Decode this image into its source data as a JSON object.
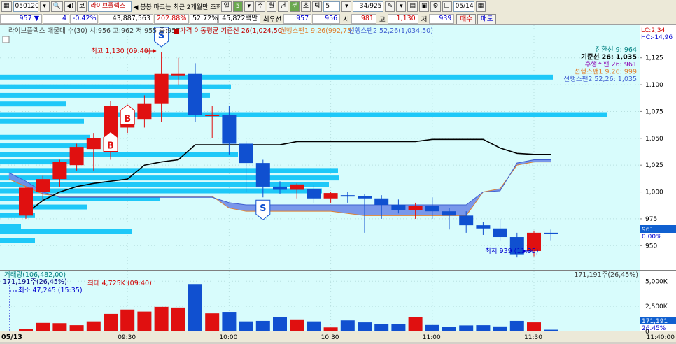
{
  "toolbar": {
    "code": "050120",
    "name": "라이브플렉스",
    "ticker_prefix": "코",
    "notice": "◀ 봉봉 마크는 최근 2개월만 조회",
    "periods": [
      "일",
      "5",
      "주",
      "월",
      "년",
      "분",
      "초",
      "틱"
    ],
    "interval": "5",
    "page": "34/925",
    "date": "05/14"
  },
  "quote": {
    "price": "957",
    "change": "4",
    "change_pct": "-0.42%",
    "volume": "43,887,563",
    "vol_ratio": "202.88%",
    "strength": "52.72%",
    "amount": "45,822백만",
    "best_label": "최우선",
    "ask": "957",
    "bid": "956",
    "open_label": "시",
    "open": "981",
    "high_label": "고",
    "high": "1,130",
    "low_label": "저",
    "low": "939",
    "buy_label": "매수",
    "sell_label": "매도"
  },
  "chart": {
    "header": "라이브플렉스 매물대 수(30) 시:956 고:962 저:955 종:957",
    "ma_label": "■가격 이동평균 기준선 26(1,024,50)",
    "span1_label": "선행스팬1 9,26(992,75)",
    "span2_label": "선행스팬2 52,26(1,034,50)",
    "lc_label": "LC:2,34",
    "hc_label": "HC:-14,96",
    "legend": [
      {
        "text": "전환선 9: 964",
        "color": "#008080"
      },
      {
        "text": "기준선 26: 1,035",
        "color": "#000000"
      },
      {
        "text": "후행스팬 26: 961",
        "color": "#8b00b0"
      },
      {
        "text": "선행스팬1 9,26: 999",
        "color": "#e08030"
      },
      {
        "text": "선행스팬2 52,26: 1,035",
        "color": "#4060d0"
      }
    ],
    "high_annot": "최고 1,130 (09:40)",
    "low_annot": "최저 939 (11:35)",
    "price_tag": "961",
    "pct_tag": "0.00%",
    "volume_header": "거래량(106,482,00)",
    "volume_right": "171,191주(26,45%)",
    "volume_current": "171,191주(26,45%)",
    "volume_min": "최소 47,245 (15:35)",
    "volume_max": "최대 4,725K (09:40)",
    "volume_tag": "171,191",
    "volume_pct_tag": "26.45%",
    "date_label": "05/13",
    "end_time": "11:40:00"
  },
  "chart_data": {
    "type": "candlestick",
    "interval_minutes": 5,
    "price_axis": {
      "min": 930,
      "max": 1145,
      "ticks": [
        950,
        975,
        1000,
        1025,
        1050,
        1075,
        1100,
        1125
      ]
    },
    "price_tick_labels": [
      "950",
      "975",
      "1,000",
      "1,025",
      "1,050",
      "1,075",
      "1,100",
      "1,125"
    ],
    "volume_axis": {
      "max": 5300,
      "ticks": [
        0,
        2500,
        5000
      ],
      "tick_labels": [
        "0",
        "2,500K",
        "5,000K"
      ]
    },
    "time_labels": [
      "09:30",
      "10:00",
      "10:30",
      "11:00",
      "11:30"
    ],
    "candles": [
      {
        "o": 978,
        "h": 1005,
        "l": 975,
        "c": 1004
      },
      {
        "o": 1000,
        "h": 1015,
        "l": 992,
        "c": 1012
      },
      {
        "o": 1012,
        "h": 1030,
        "l": 1005,
        "c": 1028
      },
      {
        "o": 1025,
        "h": 1045,
        "l": 1020,
        "c": 1042
      },
      {
        "o": 1040,
        "h": 1055,
        "l": 1020,
        "c": 1050
      },
      {
        "o": 1050,
        "h": 1085,
        "l": 1030,
        "c": 1080
      },
      {
        "o": 1060,
        "h": 1075,
        "l": 1055,
        "c": 1068
      },
      {
        "o": 1068,
        "h": 1090,
        "l": 1060,
        "c": 1082
      },
      {
        "o": 1082,
        "h": 1130,
        "l": 1065,
        "c": 1110
      },
      {
        "o": 1110,
        "h": 1125,
        "l": 1100,
        "c": 1110
      },
      {
        "o": 1110,
        "h": 1120,
        "l": 1065,
        "c": 1072
      },
      {
        "o": 1072,
        "h": 1080,
        "l": 1050,
        "c": 1072
      },
      {
        "o": 1072,
        "h": 1080,
        "l": 1035,
        "c": 1045
      },
      {
        "o": 1045,
        "h": 1048,
        "l": 1000,
        "c": 1027
      },
      {
        "o": 1027,
        "h": 1030,
        "l": 995,
        "c": 1005
      },
      {
        "o": 1005,
        "h": 1010,
        "l": 998,
        "c": 1002
      },
      {
        "o": 1002,
        "h": 1008,
        "l": 994,
        "c": 1007
      },
      {
        "o": 1003,
        "h": 1006,
        "l": 990,
        "c": 994
      },
      {
        "o": 994,
        "h": 1000,
        "l": 990,
        "c": 999
      },
      {
        "o": 997,
        "h": 1000,
        "l": 990,
        "c": 996
      },
      {
        "o": 996,
        "h": 998,
        "l": 962,
        "c": 994
      },
      {
        "o": 994,
        "h": 997,
        "l": 975,
        "c": 988
      },
      {
        "o": 988,
        "h": 993,
        "l": 980,
        "c": 983
      },
      {
        "o": 983,
        "h": 990,
        "l": 975,
        "c": 987
      },
      {
        "o": 987,
        "h": 995,
        "l": 975,
        "c": 982
      },
      {
        "o": 982,
        "h": 985,
        "l": 965,
        "c": 978
      },
      {
        "o": 978,
        "h": 982,
        "l": 962,
        "c": 969
      },
      {
        "o": 969,
        "h": 972,
        "l": 960,
        "c": 966
      },
      {
        "o": 966,
        "h": 975,
        "l": 955,
        "c": 958
      },
      {
        "o": 958,
        "h": 962,
        "l": 939,
        "c": 942
      },
      {
        "o": 945,
        "h": 964,
        "l": 940,
        "c": 962
      },
      {
        "o": 962,
        "h": 965,
        "l": 955,
        "c": 961
      }
    ],
    "volumes": [
      260,
      850,
      820,
      620,
      1000,
      1750,
      2180,
      1980,
      2450,
      2380,
      4725,
      1800,
      1950,
      1000,
      1050,
      1450,
      1200,
      1000,
      400,
      1100,
      900,
      760,
      740,
      1400,
      640,
      470,
      600,
      620,
      500,
      1050,
      900,
      171
    ],
    "kijun": [
      980,
      992,
      1000,
      1005,
      1008,
      1010,
      1012,
      1025,
      1028,
      1030,
      1044,
      1044,
      1044,
      1044,
      1044,
      1044,
      1047,
      1047,
      1047,
      1047,
      1047,
      1047,
      1047,
      1047,
      1049,
      1049,
      1049,
      1049,
      1041,
      1036,
      1035,
      1035
    ],
    "span1": [
      1012,
      1005,
      998,
      996,
      996,
      996,
      996,
      996,
      996,
      996,
      996,
      996,
      996,
      985,
      982,
      982,
      982,
      982,
      982,
      982,
      980,
      978,
      978,
      978,
      978,
      978,
      978,
      978,
      1000,
      1003,
      1025,
      1028,
      1028
    ],
    "span2": [
      1018,
      1010,
      1000,
      995,
      995,
      995,
      995,
      995,
      995,
      995,
      995,
      995,
      995,
      990,
      988,
      988,
      988,
      988,
      988,
      988,
      988,
      988,
      988,
      988,
      988,
      988,
      988,
      988,
      1000,
      1001,
      1027,
      1030,
      1030
    ],
    "signals": [
      {
        "type": "S",
        "candle": 8,
        "where": "above"
      },
      {
        "type": "B",
        "candle": 5,
        "where": "below"
      },
      {
        "type": "B",
        "candle": 6,
        "where": "below"
      },
      {
        "type": "S",
        "candle": 14,
        "where": "below"
      }
    ],
    "volume_profile_prices": [
      1107,
      1098,
      1090,
      1082,
      1072,
      1066,
      1051,
      1043,
      1035,
      1028,
      1020,
      1013,
      1007,
      1001,
      994,
      986,
      978,
      968,
      963,
      955
    ],
    "volume_profile_lengths": [
      790,
      330,
      300,
      95,
      868,
      120,
      128,
      130,
      340,
      100,
      483,
      485,
      470,
      460,
      228,
      124,
      50,
      30,
      188,
      50
    ],
    "time_tick_indices": [
      6,
      12,
      18,
      24,
      30
    ]
  }
}
